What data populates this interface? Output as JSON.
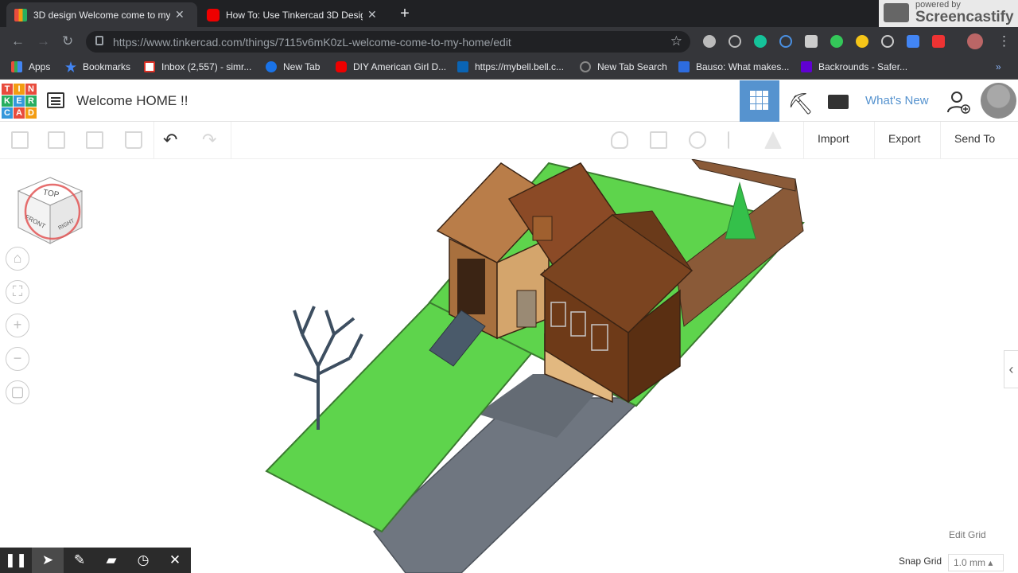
{
  "browser": {
    "tabs": [
      {
        "title": "3D design Welcome come to my",
        "active": true,
        "favicon": "tinkercad"
      },
      {
        "title": "How To: Use Tinkercad 3D Design",
        "active": false,
        "favicon": "youtube"
      }
    ],
    "new_tab": "+",
    "url": "https://www.tinkercad.com/things/7115v6mK0zL-welcome-come-to-my-home/edit",
    "url_host": "www.tinkercad.com",
    "recorder_overlay": {
      "powered_by": "powered by",
      "name": "Screencastify"
    },
    "bookmarks": [
      {
        "label": "Apps",
        "icon": "apps-grid-icon"
      },
      {
        "label": "Bookmarks",
        "icon": "star-icon"
      },
      {
        "label": "Inbox (2,557) - simr...",
        "icon": "gmail-icon"
      },
      {
        "label": "New Tab",
        "icon": "new-tab-icon"
      },
      {
        "label": "DIY American Girl D...",
        "icon": "youtube-icon"
      },
      {
        "label": "https://mybell.bell.c...",
        "icon": "bell-icon"
      },
      {
        "label": "New Tab Search",
        "icon": "search-icon"
      },
      {
        "label": "Bauso: What makes...",
        "icon": "c-icon"
      },
      {
        "label": "Backrounds - Safer...",
        "icon": "yahoo-icon"
      }
    ],
    "more": "»"
  },
  "tinkercad": {
    "logo": [
      "TIN",
      "KER",
      "CAD"
    ],
    "design_title": "Welcome HOME !!",
    "header_right": {
      "whats_new": "What's New"
    },
    "toolbar": {
      "import": "Import",
      "export": "Export",
      "send_to": "Send To"
    },
    "viewcube": {
      "top": "TOP",
      "front": "FRONT",
      "right": "RIGHT"
    },
    "edit_grid": "Edit Grid",
    "snap_grid_label": "Snap Grid",
    "snap_grid_value": "1.0 mm"
  },
  "recorder_controls": [
    "pause",
    "pointer",
    "pen",
    "highlighter",
    "timer",
    "close"
  ],
  "colors": {
    "tinkercad_blue": "#5693cf",
    "grass": "#5ed44c",
    "house_brown": "#7b4420",
    "driveway": "#6f7680"
  }
}
